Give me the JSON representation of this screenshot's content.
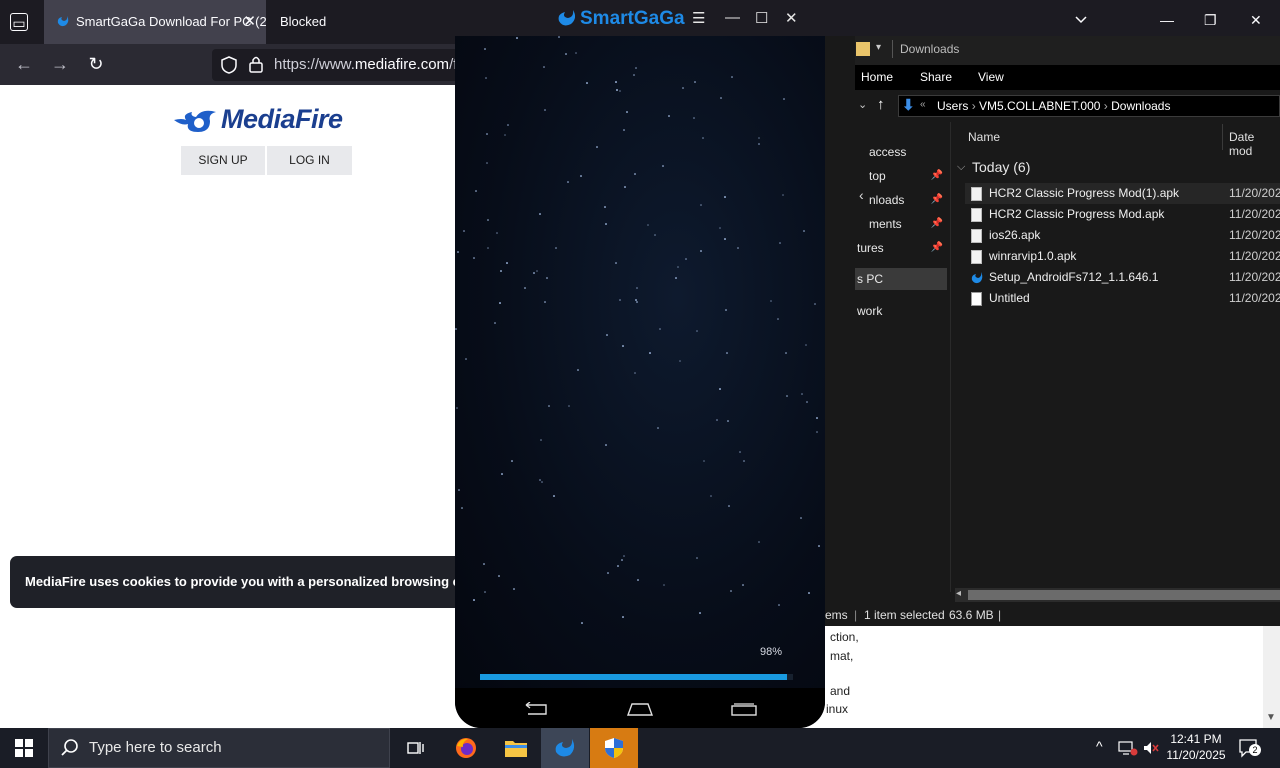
{
  "browser": {
    "tabs": [
      {
        "label": "SmartGaGa Download For PC (2",
        "active": true
      },
      {
        "label": "Blocked",
        "active": false
      }
    ],
    "url_prefix": "https://www.",
    "url_domain": "mediafire.com",
    "url_suffix": "/fil"
  },
  "mediafire": {
    "logo_text": "MediaFire",
    "signup_label": "SIGN UP",
    "login_label": "LOG IN",
    "cookie_text": "MediaFire uses cookies to provide you with a personalized browsing experi",
    "page_lines": [
      "ction,",
      "mat,",
      "and",
      "inux"
    ]
  },
  "emulator": {
    "title": "SmartGaGa",
    "progress_label": "98%",
    "progress": 0.98
  },
  "explorer": {
    "title": "Downloads",
    "ribbon_tabs": [
      "Home",
      "Share",
      "View"
    ],
    "breadcrumb": [
      "Users",
      "VM5.COLLABNET.000",
      "Downloads"
    ],
    "nav_items": [
      {
        "label": "access",
        "pinned": false
      },
      {
        "label": "top",
        "pinned": true
      },
      {
        "label": "nloads",
        "pinned": true
      },
      {
        "label": "ments",
        "pinned": true
      },
      {
        "label": "tures",
        "pinned": true
      },
      {
        "label": "s PC",
        "pinned": false
      },
      {
        "label": "work",
        "pinned": false
      }
    ],
    "columns": {
      "name": "Name",
      "date": "Date mod"
    },
    "group": "Today (6)",
    "files": [
      {
        "name": "HCR2 Classic Progress Mod(1).apk",
        "date": "11/20/202",
        "selected": true
      },
      {
        "name": "HCR2 Classic Progress Mod.apk",
        "date": "11/20/202",
        "selected": false
      },
      {
        "name": "ios26.apk",
        "date": "11/20/202",
        "selected": false
      },
      {
        "name": "winrarvip1.0.apk",
        "date": "11/20/202",
        "selected": false
      },
      {
        "name": "Setup_AndroidFs712_1.1.646.1",
        "date": "11/20/202",
        "selected": false
      },
      {
        "name": "Untitled",
        "date": "11/20/202",
        "selected": false
      }
    ],
    "status_items": "ems",
    "status_selected": "1 item selected",
    "status_size": "63.6 MB"
  },
  "taskbar": {
    "search_placeholder": "Type here to search",
    "time": "12:41 PM",
    "date": "11/20/2025",
    "notification_count": "2"
  },
  "colors": {
    "accent": "#199ae0",
    "mediafire_blue": "#1b3f8f",
    "taskbar_shield": "#d77b12"
  },
  "icons": {
    "side_toolbar": [
      "fullscreen-icon",
      "keyboard-icon",
      "apk-install-icon",
      "volume-up-icon",
      "volume-down-icon",
      "scissors-icon",
      "add-app-icon",
      "location-icon",
      "shake-icon",
      "settings-icon"
    ]
  }
}
